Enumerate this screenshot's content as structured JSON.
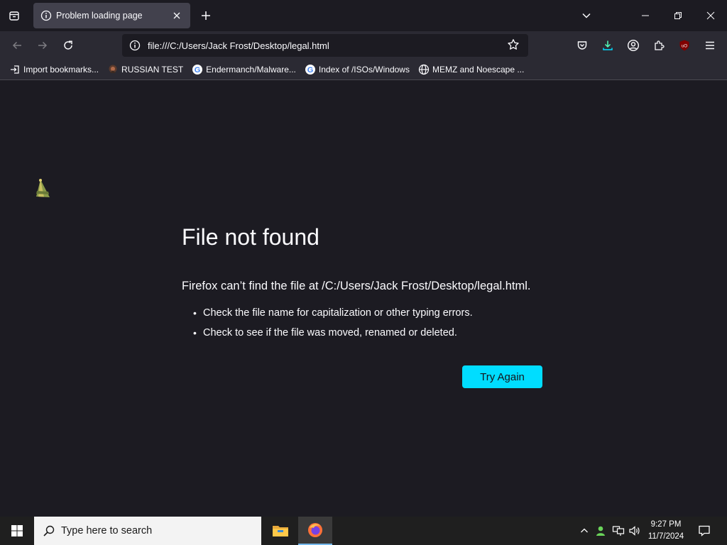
{
  "browser": {
    "tab": {
      "title": "Problem loading page"
    },
    "url": "file:///C:/Users/Jack Frost/Desktop/legal.html",
    "bookmarks": [
      {
        "label": "Import bookmarks...",
        "icon": "import-icon"
      },
      {
        "label": "RUSSIAN TEST",
        "icon": "site-favicon"
      },
      {
        "label": "Endermanch/Malware...",
        "icon": "google-icon"
      },
      {
        "label": "Index of /ISOs/Windows",
        "icon": "google-icon"
      },
      {
        "label": "MEMZ and Noescape ...",
        "icon": "globe-icon"
      }
    ]
  },
  "error": {
    "title": "File not found",
    "description": "Firefox can’t find the file at /C:/Users/Jack Frost/Desktop/legal.html.",
    "tips": [
      "Check the file name for capitalization or other typing errors.",
      "Check to see if the file was moved, renamed or deleted."
    ],
    "button": "Try Again"
  },
  "taskbar": {
    "search_placeholder": "Type here to search",
    "time": "9:27 PM",
    "date": "11/7/2024"
  },
  "colors": {
    "accent_button": "#00ddff",
    "page_bg": "#1c1b22",
    "toolbar_bg": "#2b2a33"
  }
}
